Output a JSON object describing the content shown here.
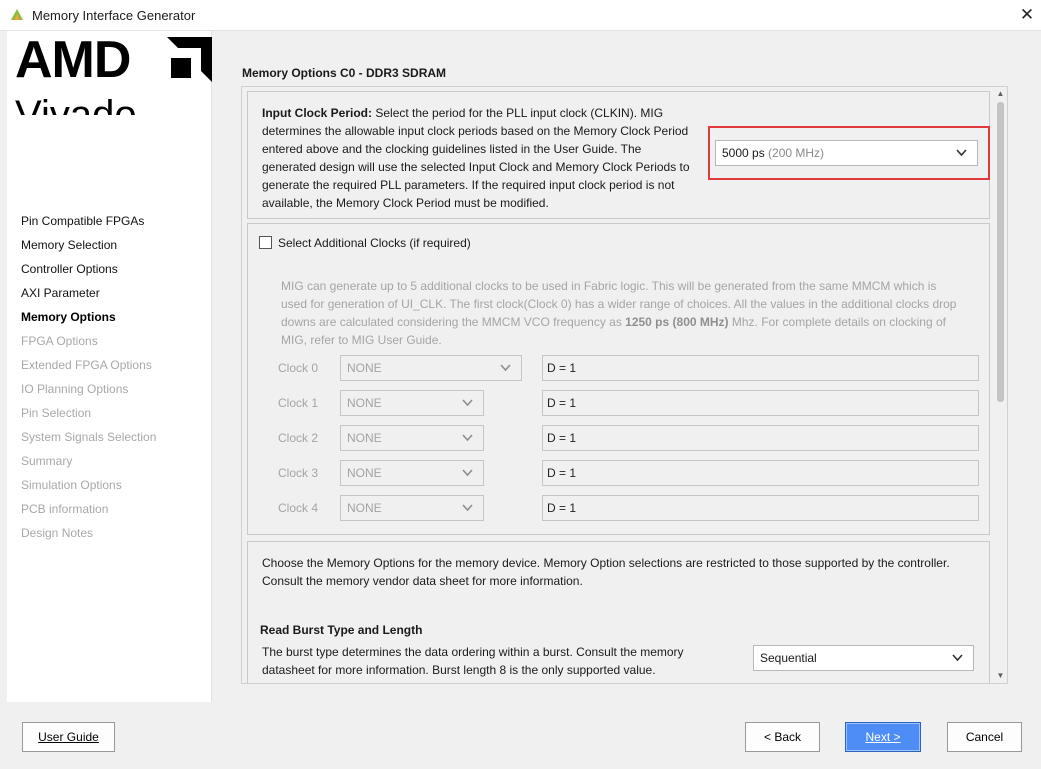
{
  "window": {
    "title": "Memory Interface Generator",
    "close_glyph": "✕"
  },
  "branding": {
    "company": "AMD",
    "product": "Vivado"
  },
  "nav": {
    "items": [
      {
        "label": "Pin Compatible FPGAs",
        "state": "done"
      },
      {
        "label": "Memory Selection",
        "state": "done"
      },
      {
        "label": "Controller Options",
        "state": "done"
      },
      {
        "label": "AXI Parameter",
        "state": "done"
      },
      {
        "label": "Memory Options",
        "state": "current"
      },
      {
        "label": "FPGA Options",
        "state": "pending"
      },
      {
        "label": "Extended FPGA Options",
        "state": "pending"
      },
      {
        "label": "IO Planning Options",
        "state": "pending"
      },
      {
        "label": "Pin Selection",
        "state": "pending"
      },
      {
        "label": "System Signals Selection",
        "state": "pending"
      },
      {
        "label": "Summary",
        "state": "pending"
      },
      {
        "label": "Simulation Options",
        "state": "pending"
      },
      {
        "label": "PCB information",
        "state": "pending"
      },
      {
        "label": "Design Notes",
        "state": "pending"
      }
    ]
  },
  "main": {
    "section_title": "Memory Options C0 - DDR3 SDRAM",
    "input_clock": {
      "heading": "Input Clock Period:",
      "description_lines": [
        " Select the period for the PLL input clock (CLKIN). MIG",
        "determines the allowable input clock periods based on the Memory Clock Period",
        "entered above and the clocking guidelines listed in the User Guide. The",
        "generated design will use the selected Input Clock and Memory Clock Periods to",
        "generate the required PLL parameters. If the required input clock period is not",
        "available, the Memory Clock Period must be modified."
      ],
      "selected_value": "5000 ps",
      "selected_freq": "(200 MHz)"
    },
    "additional_clocks": {
      "checkbox_label": "Select Additional Clocks (if required)",
      "checked": false,
      "info_lines": [
        "MIG can generate up to 5 additional clocks to be used in Fabric logic. This will be generated from the same MMCM which is",
        "used for generation of UI_CLK. The first clock(Clock 0) has a wider range of choices. All the values in the additional clocks drop",
        "MIG, refer to MIG User Guide."
      ],
      "info_line3_pre": "downs are calculated considering the MMCM VCO frequency as ",
      "info_line3_bold": "1250 ps (800 MHz)",
      "info_line3_post": " Mhz. For complete details on clocking of",
      "clocks": [
        {
          "label": "Clock 0",
          "value": "NONE",
          "divider": "D = 1"
        },
        {
          "label": "Clock 1",
          "value": "NONE",
          "divider": "D = 1"
        },
        {
          "label": "Clock 2",
          "value": "NONE",
          "divider": "D = 1"
        },
        {
          "label": "Clock 3",
          "value": "NONE",
          "divider": "D = 1"
        },
        {
          "label": "Clock 4",
          "value": "NONE",
          "divider": "D = 1"
        }
      ]
    },
    "memory_options": {
      "intro_lines": [
        "Choose the Memory Options for the memory device. Memory Option selections are restricted to those supported by the controller.",
        "Consult the memory vendor data sheet for more information."
      ],
      "burst_heading": "Read Burst Type and Length",
      "burst_desc_lines": [
        "The burst type determines the data ordering within a burst. Consult the memory",
        "datasheet for more information. Burst length 8 is the only supported value."
      ],
      "burst_value": "Sequential"
    }
  },
  "footer": {
    "user_guide": "User Guide",
    "back": "< Back",
    "next": "Next >",
    "cancel": "Cancel"
  },
  "colors": {
    "highlight": "#e03a3a",
    "primary_button": "#4e8df5"
  }
}
